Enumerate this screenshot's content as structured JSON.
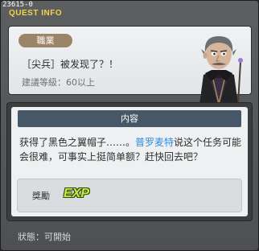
{
  "quest_id": "23615-0",
  "window_title": "QUEST INFO",
  "top": {
    "job_tag": "職業",
    "quest_name": "［尖兵］被发现了？！",
    "recommended_level": "建議等級：60以上"
  },
  "content": {
    "header": "内容",
    "text_before": "获得了黑色之翼帽子……。",
    "npc_name": "普罗麦特",
    "text_after": "说这个任务可能会很难，可事实上挺简单额？赶快回去吧？"
  },
  "reward": {
    "label": "獎勵",
    "exp": "EXP"
  },
  "status": "狀態：可開始",
  "colors": {
    "title": "#f2d34a",
    "npc_link": "#2f8de0",
    "header_bar": "#465867",
    "job_tag": "#9b8468",
    "exp": "#c9ec3a"
  },
  "icons": {
    "npc": "npc-portrait-icon",
    "exp": "exp-icon"
  }
}
